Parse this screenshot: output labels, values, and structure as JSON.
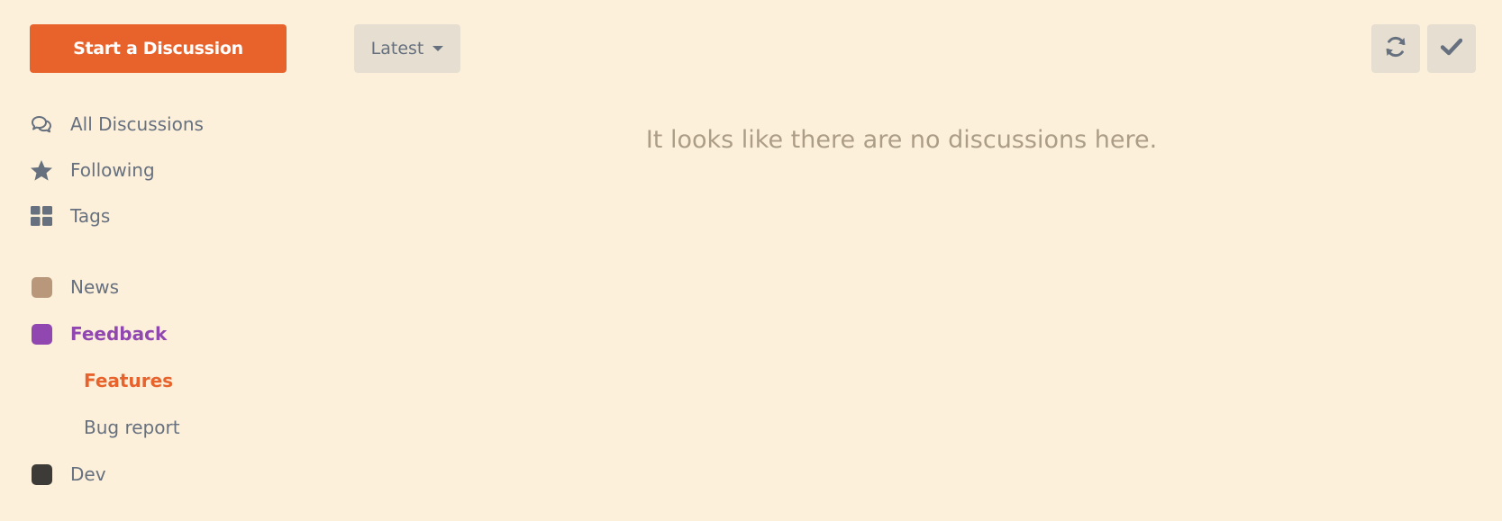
{
  "sidebar": {
    "start_label": "Start a Discussion",
    "nav": [
      {
        "label": "All Discussions",
        "icon": "chat-bubbles-icon"
      },
      {
        "label": "Following",
        "icon": "star-icon"
      },
      {
        "label": "Tags",
        "icon": "grid-icon"
      }
    ],
    "tags": [
      {
        "label": "News",
        "color": "#b8977a"
      },
      {
        "label": "Feedback",
        "color": "#9048b0",
        "active": true
      },
      {
        "label": "Dev",
        "color": "#3d3b37"
      }
    ],
    "subtags": [
      {
        "label": "Features",
        "active": true
      },
      {
        "label": "Bug report"
      }
    ]
  },
  "toolbar": {
    "sort_label": "Latest",
    "refresh_icon": "refresh-icon",
    "mark_read_icon": "check-icon"
  },
  "main": {
    "empty_message": "It looks like there are no discussions here."
  },
  "colors": {
    "background": "#fdf0db",
    "primary": "#e8632c",
    "text": "#66707e",
    "muted": "#ab9d86",
    "button_bg": "#e6dfd1"
  }
}
